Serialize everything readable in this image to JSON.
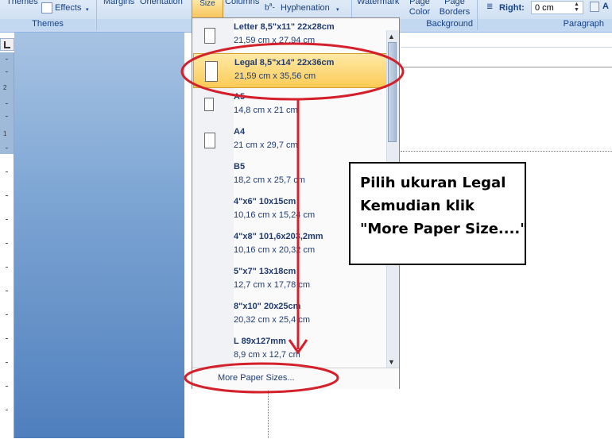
{
  "ribbon": {
    "themes_label": "Themes",
    "effects_label": "Effects",
    "themes_group": "Themes",
    "margins_label": "Margins",
    "orientation_label": "Orientation",
    "size_label": "Size",
    "columns_label": "Columns",
    "hyphenation_label": "Hyphenation",
    "watermark_label": "Watermark",
    "page_color_label": "Page Color",
    "page_borders_label": "Page Borders",
    "background_group": "Background",
    "right_label": "Right:",
    "right_value": "0 cm",
    "paragraph_group": "Paragraph",
    "a_label": "A"
  },
  "ruler": {
    "numbers": [
      "2",
      "1"
    ]
  },
  "paper_sizes": {
    "items": [
      {
        "name": "Letter 8,5\"x11\" 22x28cm",
        "dim": "21,59 cm x 27,94 cm"
      },
      {
        "name": "Legal 8,5\"x14\" 22x36cm",
        "dim": "21,59 cm x 35,56 cm"
      },
      {
        "name": "A5",
        "dim": "14,8 cm x 21 cm"
      },
      {
        "name": "A4",
        "dim": "21 cm x 29,7 cm"
      },
      {
        "name": "B5",
        "dim": "18,2 cm x 25,7 cm"
      },
      {
        "name": "4\"x6\" 10x15cm",
        "dim": "10,16 cm x 15,24 cm"
      },
      {
        "name": "4\"x8\" 101,6x203,2mm",
        "dim": "10,16 cm x 20,32 cm"
      },
      {
        "name": "5\"x7\" 13x18cm",
        "dim": "12,7 cm x 17,78 cm"
      },
      {
        "name": "8\"x10\" 20x25cm",
        "dim": "20,32 cm x 25,4 cm"
      },
      {
        "name": "L 89x127mm",
        "dim": "8,9 cm x 12,7 cm"
      }
    ],
    "more_label": "More Paper Sizes..."
  },
  "annotation": {
    "line1": "Pilih ukuran Legal",
    "line2": "Kemudian klik",
    "line3": "\"More Paper Size....\""
  },
  "colors": {
    "ribbon_text": "#15428b",
    "highlight": "#fbcb56",
    "annotation_red": "#d4202a"
  }
}
